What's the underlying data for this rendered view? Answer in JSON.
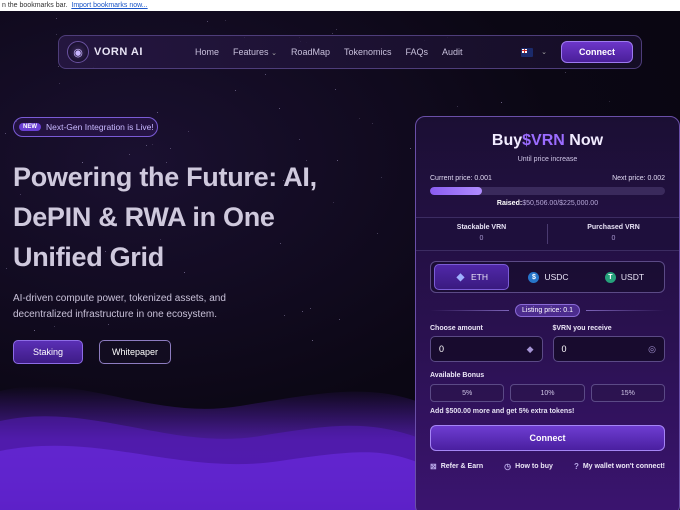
{
  "bookmarks_bar": {
    "text": "n the bookmarks bar.",
    "link": "Import bookmarks now..."
  },
  "nav": {
    "logo": "VORN AI",
    "links": [
      "Home",
      "Features",
      "RoadMap",
      "Tokenomics",
      "FAQs",
      "Audit"
    ],
    "connect_label": "Connect"
  },
  "hero": {
    "badge_new": "NEW",
    "badge_text": "Next-Gen Integration is Live!",
    "title_line1": "Powering the Future: AI,",
    "title_line2": "DePIN & RWA in One",
    "title_line3": "Unified Grid",
    "subtitle": "AI-driven compute power, tokenized assets, and decentralized infrastructure in one ecosystem.",
    "staking_label": "Staking",
    "whitepaper_label": "Whitepaper"
  },
  "buy": {
    "title_prefix": "Buy",
    "title_token": "$VRN",
    "title_suffix": "Now",
    "until": "Until price increase",
    "current_price": "Current price: 0.001",
    "next_price": "Next price: 0.002",
    "progress": 0.22,
    "raised_label": "Raised:",
    "raised_amount": "$50,506.00/$225,000.00",
    "stackable_label": "Stackable VRN",
    "stackable_value": "0",
    "purchased_label": "Purchased VRN",
    "purchased_value": "0",
    "tokens": [
      "ETH",
      "USDC",
      "USDT"
    ],
    "listing": "Listing price: 0.1",
    "choose_label": "Choose amount",
    "choose_value": "0",
    "receive_label": "$VRN you receive",
    "receive_value": "0",
    "bonus_label": "Available Bonus",
    "bonuses": [
      "5%",
      "10%",
      "15%"
    ],
    "bonus_note": "Add $500.00 more and get 5% extra tokens!",
    "connect_label": "Connect",
    "refer": "Refer & Earn",
    "how_to": "How to buy",
    "wallet": "My wallet won't connect!"
  },
  "colors": {
    "accent": "#7b4ae0",
    "token_accent": "#9b6cff"
  }
}
